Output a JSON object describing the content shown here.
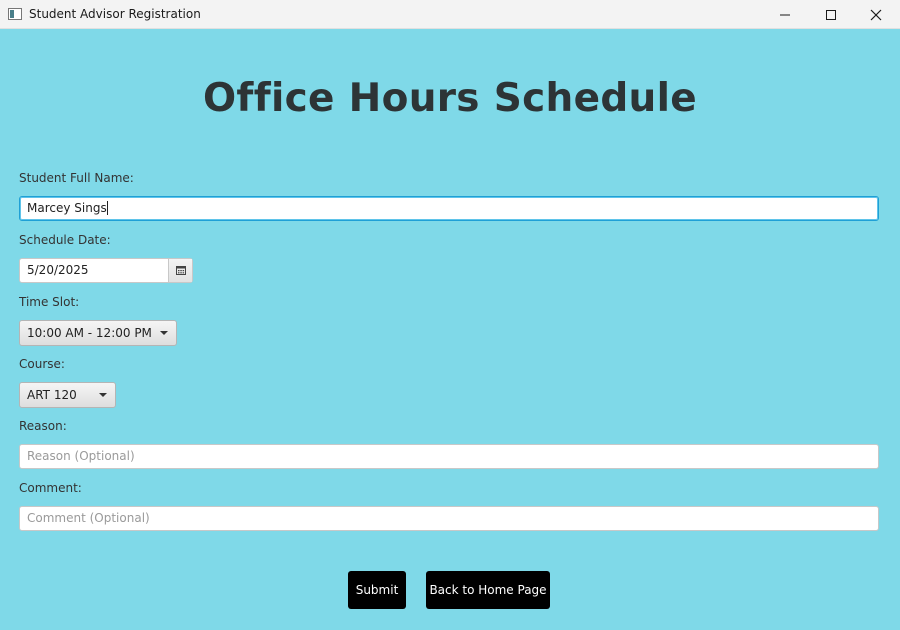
{
  "window": {
    "title": "Student Advisor Registration",
    "app_icon": "window-app-icon"
  },
  "heading": "Office Hours Schedule",
  "form": {
    "name_label": "Student Full Name:",
    "name_value": "Marcey Sings",
    "date_label": "Schedule Date:",
    "date_value": "5/20/2025",
    "time_label": "Time Slot:",
    "time_value": "10:00 AM - 12:00 PM",
    "course_label": "Course:",
    "course_value": "ART 120",
    "reason_label": "Reason:",
    "reason_placeholder": "Reason (Optional)",
    "comment_label": "Comment:",
    "comment_placeholder": "Comment (Optional)"
  },
  "buttons": {
    "submit": "Submit",
    "back": "Back to Home Page"
  },
  "colors": {
    "background": "#7fd9e8",
    "button": "#000000",
    "focus": "#1fa0d6"
  }
}
